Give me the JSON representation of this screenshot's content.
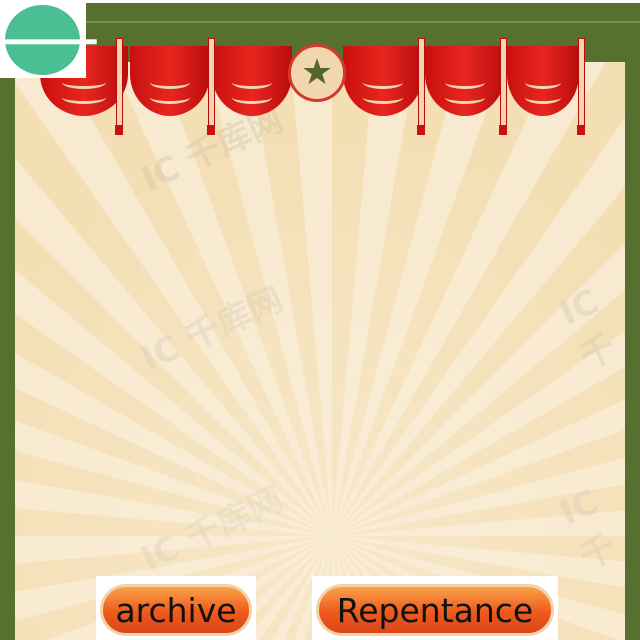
{
  "back_button": {
    "icon": "arrow-left-icon"
  },
  "buttons": {
    "archive": "archive",
    "repentance": "Repentance"
  },
  "watermark": "IC千库网",
  "colors": {
    "frame": "#56702f",
    "accent": "#4bbf93",
    "button": "#ee5a1c",
    "banner": "#c8100f"
  }
}
